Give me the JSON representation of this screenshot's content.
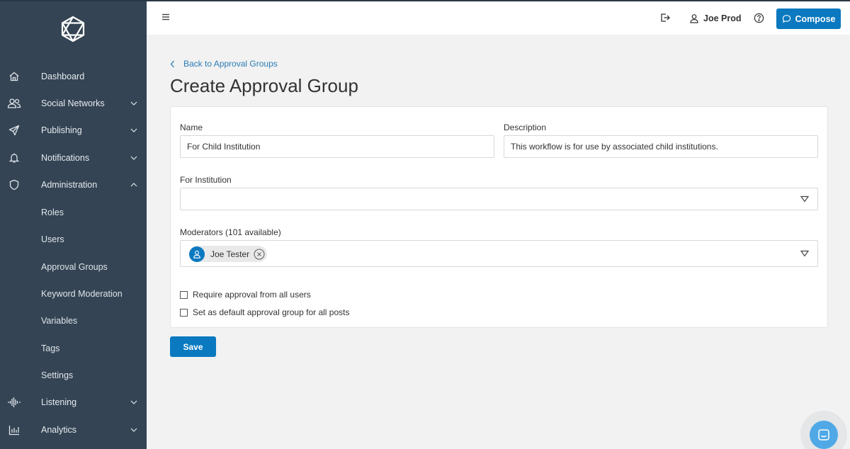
{
  "sidebar": {
    "nav": [
      {
        "label": "Dashboard",
        "icon": "home-icon"
      },
      {
        "label": "Social Networks",
        "icon": "users-icon"
      },
      {
        "label": "Publishing",
        "icon": "send-icon"
      },
      {
        "label": "Notifications",
        "icon": "bell-icon"
      },
      {
        "label": "Administration",
        "icon": "shield-icon"
      },
      {
        "label": "Listening",
        "icon": "waveform-icon"
      },
      {
        "label": "Analytics",
        "icon": "bar-chart-icon"
      }
    ],
    "admin_sub": [
      "Roles",
      "Users",
      "Approval Groups",
      "Keyword Moderation",
      "Variables",
      "Tags",
      "Settings"
    ]
  },
  "topbar": {
    "user_name": "Joe Prod",
    "compose_label": "Compose"
  },
  "page": {
    "back_label": "Back to Approval Groups",
    "title": "Create Approval Group"
  },
  "form": {
    "name_label": "Name",
    "name_value": "For Child Institution",
    "description_label": "Description",
    "description_value": "This workflow is for use by associated child institutions.",
    "institution_label": "For Institution",
    "institution_value": "",
    "moderators_label": "Moderators (101 available)",
    "moderators": [
      {
        "name": "Joe Tester"
      }
    ],
    "checkbox_require": "Require approval from all users",
    "checkbox_default": "Set as default approval group for all posts",
    "save_label": "Save"
  },
  "colors": {
    "sidebar_bg": "#344454",
    "accent": "#0b79c0",
    "link": "#2a7cb6"
  }
}
